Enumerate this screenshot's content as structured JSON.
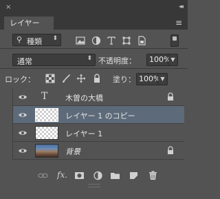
{
  "window": {
    "close_glyph": "×",
    "collapse_glyph": "◂◂"
  },
  "tabs": [
    {
      "label": "レイヤー",
      "active": true
    }
  ],
  "panel_menu_glyph": "≡",
  "filter": {
    "kind_label": "種類",
    "icons": [
      "pixel-filter-icon",
      "adjustment-filter-icon",
      "type-filter-icon",
      "shape-filter-icon",
      "smart-object-filter-icon"
    ]
  },
  "blend": {
    "mode": "通常"
  },
  "opacity": {
    "label": "不透明度：",
    "value": "100%"
  },
  "lock": {
    "label": "ロック："
  },
  "fill": {
    "label": "塗り：",
    "value": "100%"
  },
  "layers": [
    {
      "name": "木曽の大橋",
      "kind": "type",
      "type_glyph": "T",
      "visible": true,
      "locked": true,
      "selected": false
    },
    {
      "name": "レイヤー 1 のコピー",
      "kind": "pixel",
      "visible": true,
      "locked": false,
      "selected": true
    },
    {
      "name": "レイヤー 1",
      "kind": "pixel",
      "visible": true,
      "locked": false,
      "selected": false
    },
    {
      "name": "背景",
      "kind": "background",
      "visible": true,
      "locked": true,
      "selected": false
    }
  ],
  "bottom_icons": [
    "link-icon",
    "fx-icon",
    "mask-icon",
    "adjustment-icon",
    "folder-icon",
    "new-layer-icon",
    "trash-icon"
  ],
  "colors": {
    "panel": "#535353",
    "header": "#383838",
    "selection": "#5d6a79"
  }
}
